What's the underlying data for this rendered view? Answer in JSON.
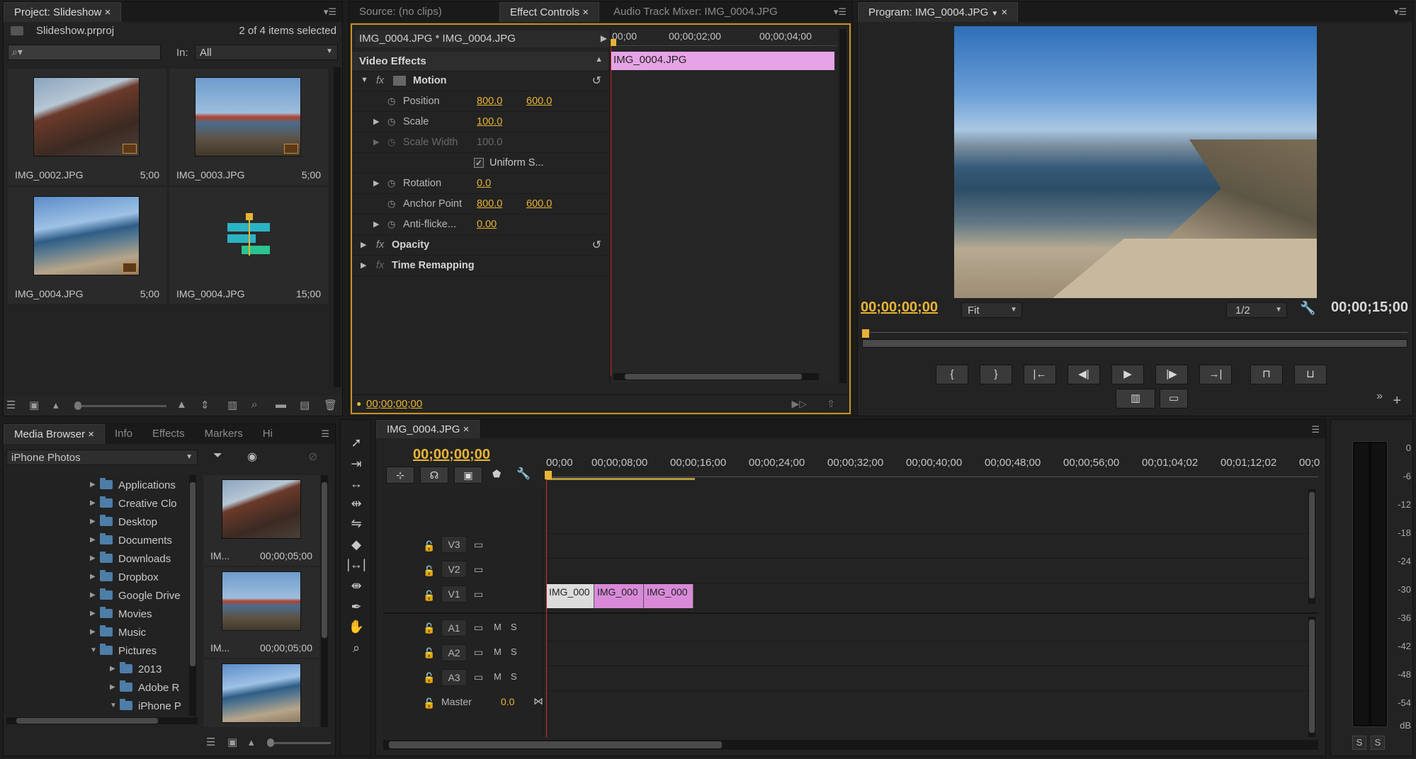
{
  "project": {
    "tab": "Project: Slideshow",
    "filename": "Slideshow.prproj",
    "selection": "2 of 4 items selected",
    "in_label": "In:",
    "in_value": "All",
    "items": [
      {
        "name": "IMG_0002.JPG",
        "duration": "5;00"
      },
      {
        "name": "IMG_0003.JPG",
        "duration": "5;00"
      },
      {
        "name": "IMG_0004.JPG",
        "duration": "5;00"
      },
      {
        "name": "IMG_0004.JPG",
        "duration": "15;00"
      }
    ]
  },
  "source_tabs": {
    "source": "Source: (no clips)",
    "effect_controls": "Effect Controls",
    "audio_mixer": "Audio Track Mixer: IMG_0004.JPG"
  },
  "effect_controls": {
    "clip_path": "IMG_0004.JPG * IMG_0004.JPG",
    "section": "Video Effects",
    "ruler": [
      "00;00",
      "00;00;02;00",
      "00;00;04;00"
    ],
    "clip_bar": "IMG_0004.JPG",
    "motion": "Motion",
    "position_label": "Position",
    "position_x": "800.0",
    "position_y": "600.0",
    "scale_label": "Scale",
    "scale_value": "100.0",
    "scale_width_label": "Scale Width",
    "scale_width_value": "100.0",
    "uniform_label": "Uniform S...",
    "rotation_label": "Rotation",
    "rotation_value": "0.0",
    "anchor_label": "Anchor Point",
    "anchor_x": "800.0",
    "anchor_y": "600.0",
    "antiflicker_label": "Anti-flicke...",
    "antiflicker_value": "0.00",
    "opacity": "Opacity",
    "time_remap": "Time Remapping",
    "timecode": "00;00;00;00"
  },
  "program": {
    "tab": "Program: IMG_0004.JPG",
    "timecode": "00;00;00;00",
    "fit": "Fit",
    "resolution": "1/2",
    "duration": "00;00;15;00"
  },
  "media_browser": {
    "tabs": [
      "Media Browser",
      "Info",
      "Effects",
      "Markers",
      "Hi"
    ],
    "source": "iPhone Photos",
    "folders": [
      "Applications",
      "Creative Clo",
      "Desktop",
      "Documents",
      "Downloads",
      "Dropbox",
      "Google Drive",
      "Movies",
      "Music",
      "Pictures",
      "2013",
      "Adobe R",
      "iPhone P"
    ],
    "clips": [
      {
        "name": "IM...",
        "duration": "00;00;05;00"
      },
      {
        "name": "IM...",
        "duration": "00;00;05;00"
      }
    ]
  },
  "timeline": {
    "tab": "IMG_0004.JPG",
    "timecode": "00;00;00;00",
    "ruler": [
      "00;00",
      "00;00;08;00",
      "00;00;16;00",
      "00;00;24;00",
      "00;00;32;00",
      "00;00;40;00",
      "00;00;48;00",
      "00;00;56;00",
      "00;01;04;02",
      "00;01;12;02",
      "00;0"
    ],
    "video_tracks": [
      "V3",
      "V2",
      "V1"
    ],
    "audio_tracks": [
      "A1",
      "A2",
      "A3"
    ],
    "master_label": "Master",
    "master_value": "0.0",
    "mute": "M",
    "solo": "S",
    "clips": [
      "IMG_000",
      "IMG_000",
      "IMG_000"
    ]
  },
  "meter": {
    "labels": [
      "0",
      "-6",
      "-12",
      "-18",
      "-24",
      "-30",
      "-36",
      "-42",
      "-48",
      "-54",
      "dB"
    ],
    "solo_buttons": [
      "S",
      "S"
    ]
  },
  "colors": {
    "accent": "#e8b436",
    "clip_pink": "#d88ad8",
    "playhead": "#d03030"
  }
}
